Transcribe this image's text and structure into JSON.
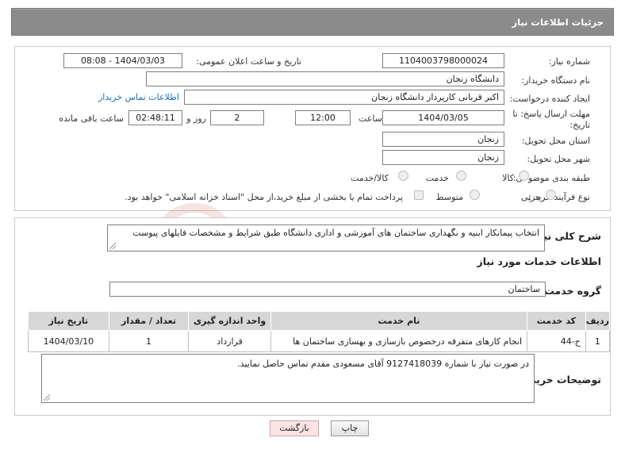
{
  "header": {
    "title": "جزئیات اطلاعات نیاز"
  },
  "fields": {
    "need_number_label": "شماره نیاز:",
    "need_number": "1104003798000024",
    "announce_label": "تاریخ و ساعت اعلان عمومی:",
    "announce_value": "1404/03/03 - 08:08",
    "buyer_org_label": "نام دستگاه خریدار:",
    "buyer_org": "دانشگاه زنجان",
    "creator_label": "ایجاد کننده درخواست:",
    "creator": "اکبر قربانی کارپرداز دانشگاه زنجان",
    "contact_link": "اطلاعات تماس خریدار",
    "deadline_label_1": "مهلت ارسال پاسخ: تا",
    "deadline_label_2": "تاریخ:",
    "deadline_date": "1404/03/05",
    "time_label": "ساعت",
    "deadline_time": "12:00",
    "days_value": "2",
    "days_label": "روز و",
    "remaining_time": "02:48:11",
    "remaining_label": "ساعت باقی مانده",
    "province_label": "استان محل تحویل:",
    "province": "زنجان",
    "city_label": "شهر محل تحویل:",
    "city": "زنجان",
    "category_label": "طبقه بندی موضوعی:",
    "category_options": [
      "کالا",
      "خدمت",
      "کالا/خدمت"
    ],
    "process_label": "نوع فرآیند خرید :",
    "process_options": [
      "جزیی",
      "متوسط"
    ],
    "payment_note": "پرداخت تمام یا بخشی از مبلغ خرید،از محل \"اسناد خزانه اسلامی\" خواهد بود."
  },
  "summary": {
    "label": "شرح کلی نیاز:",
    "text": "انتخاب پیمانکار ابنیه و نگهداری ساختمان های آموزشی و اداری دانشگاه طبق شرایط و مشخصات فایلهای پیوست"
  },
  "services": {
    "section_title": "اطلاعات خدمات مورد نیاز",
    "group_label": "گروه خدمت:",
    "group_value": "ساختمان",
    "columns": [
      "ردیف",
      "کد خدمت",
      "نام خدمت",
      "واحد اندازه گیری",
      "تعداد / مقدار",
      "تاریخ نیاز"
    ],
    "rows": [
      [
        "1",
        "ج-44",
        "انجام کارهای متفرقه درخصوص بازسازی و بهسازی ساختمان ها",
        "قرارداد",
        "1",
        "1404/03/10"
      ]
    ]
  },
  "buyer_notes": {
    "label": "توضیحات خریدار:",
    "text": "در صورت نیاز با شماره 9127418039 آقای مسعودی مقدم تماس حاصل نمایید."
  },
  "buttons": {
    "print": "چاپ",
    "back": "بازگشت"
  },
  "watermark": {
    "text": "AriaTender.neT"
  },
  "colors": {
    "header_bg": "#8b8b8b",
    "link": "#1a6fb5",
    "back_button_bg": "#fde4e4",
    "watermark": "#c0392b"
  }
}
